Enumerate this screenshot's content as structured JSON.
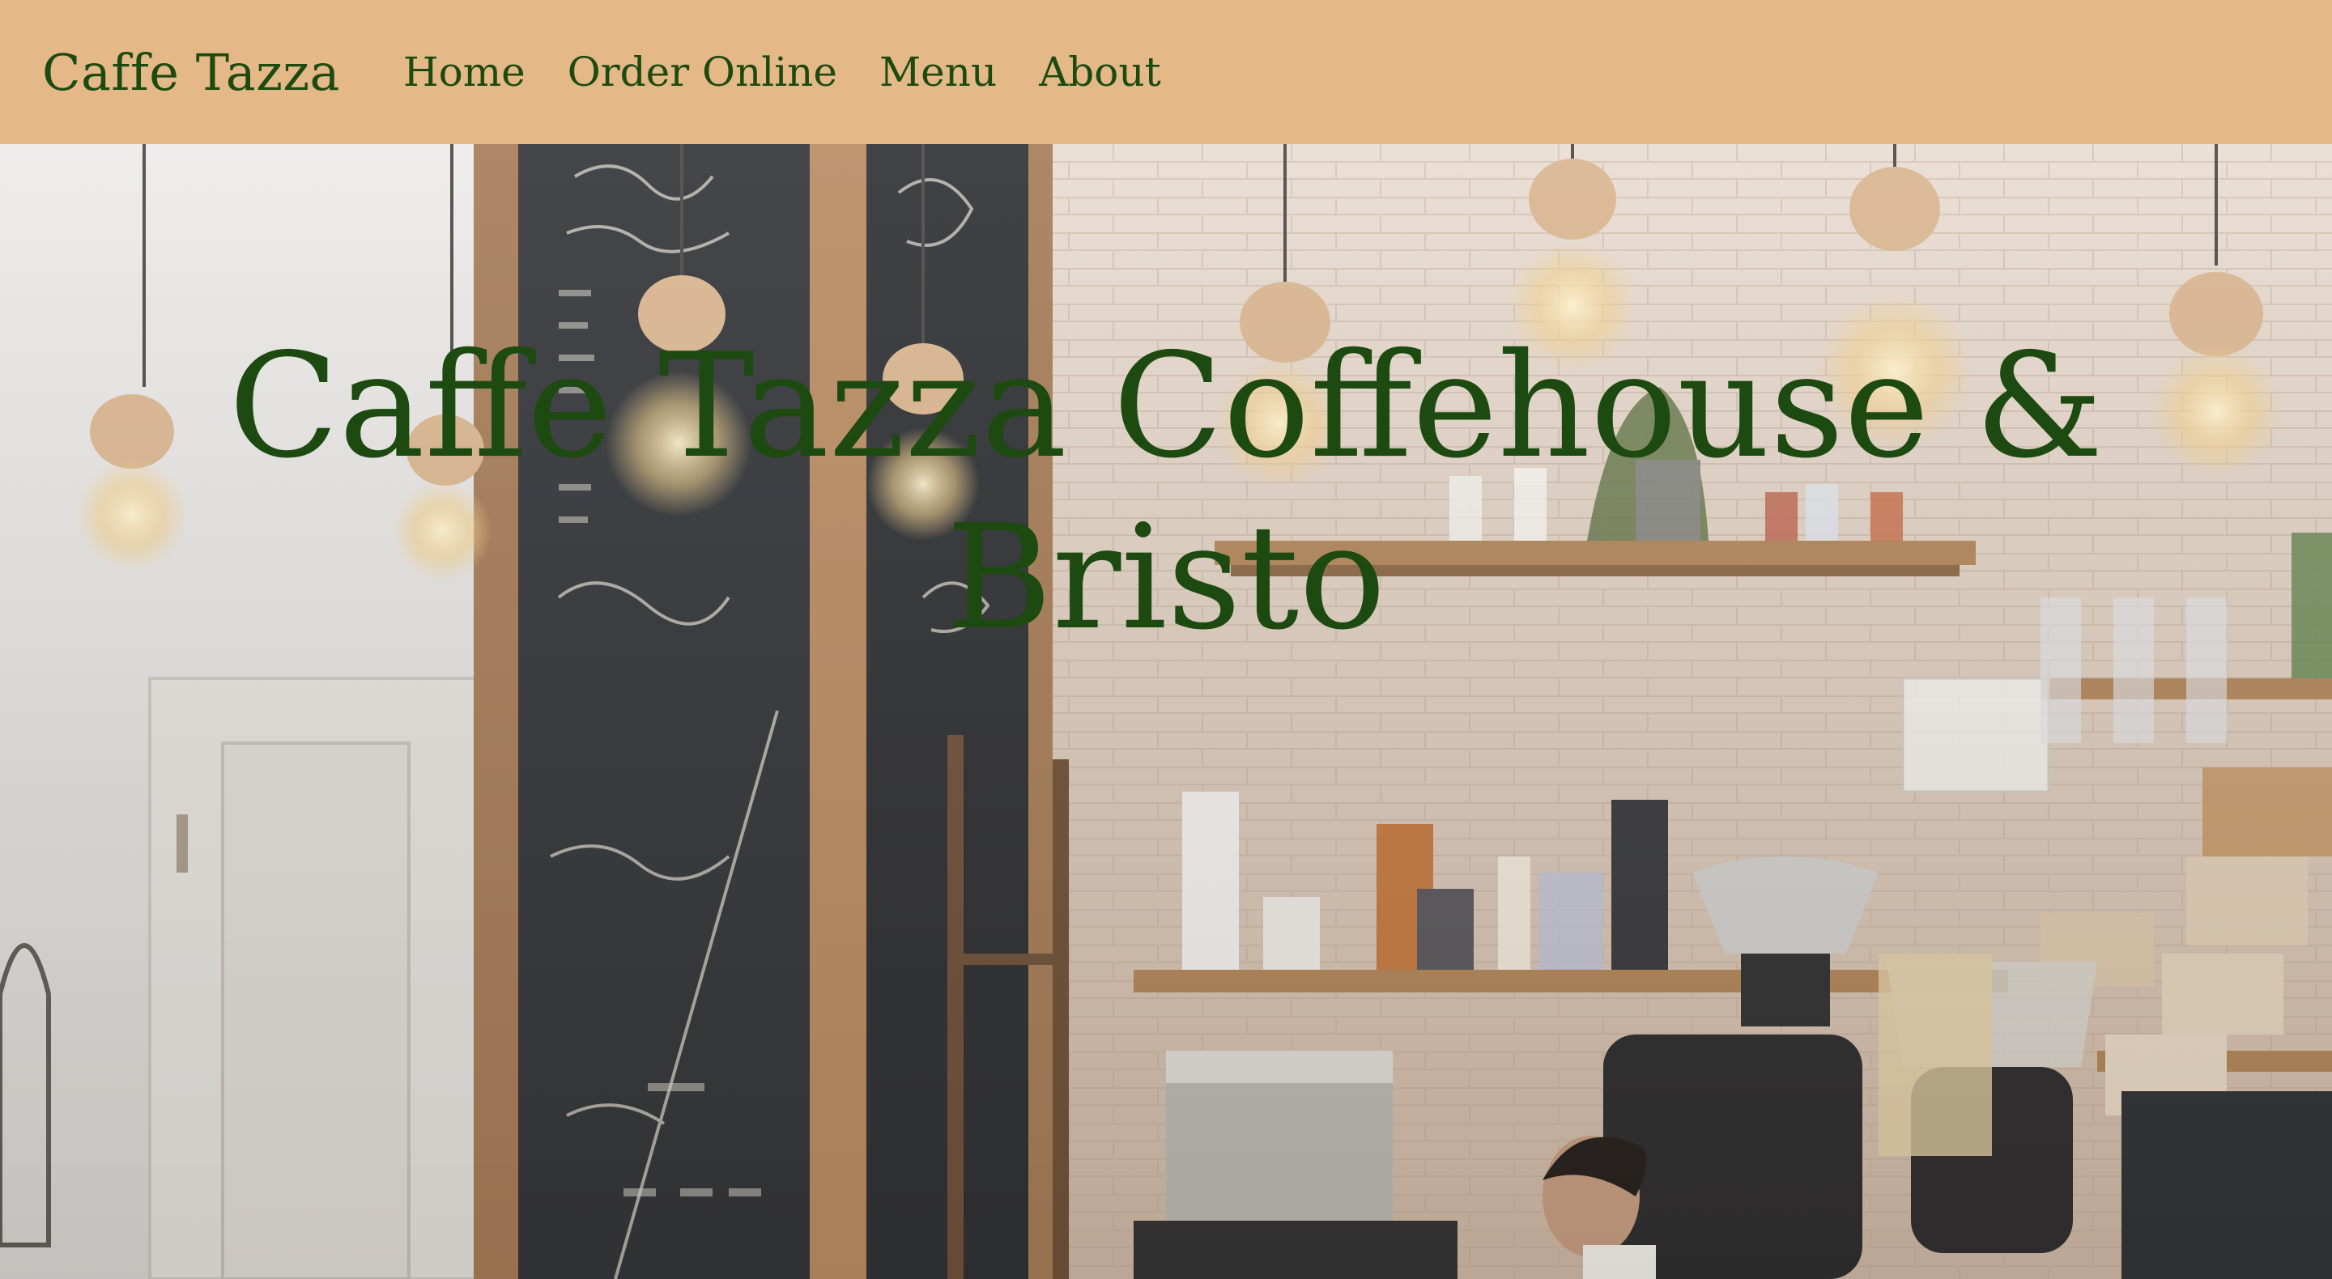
{
  "nav": {
    "brand": "Caffe Tazza",
    "links": [
      "Home",
      "Order Online",
      "Menu",
      "About"
    ]
  },
  "hero": {
    "title_line1": "Caffe Tazza Coffehouse &",
    "title_line2": "Bristo"
  },
  "colors": {
    "navbar_bg": "#e4b887",
    "text_green": "#1d4a10"
  }
}
